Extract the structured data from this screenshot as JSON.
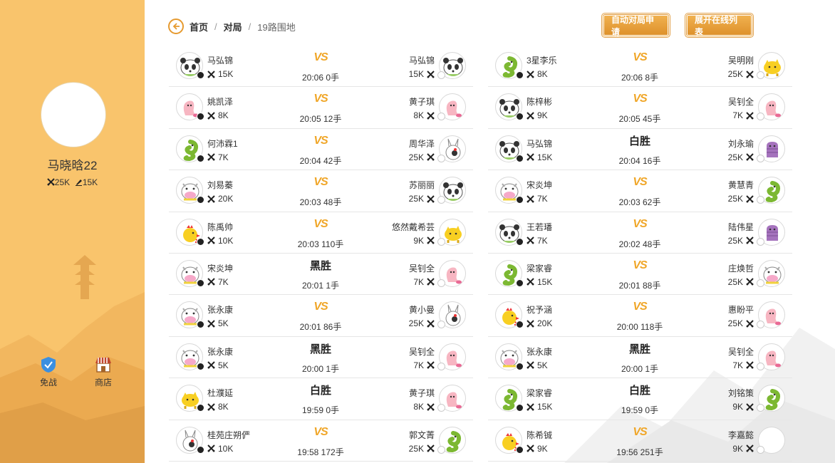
{
  "profile": {
    "name": "马晓晗22",
    "rank_a": "25K",
    "rank_b": "15K"
  },
  "sidebar": {
    "free_label": "免战",
    "shop_label": "商店"
  },
  "breadcrumb": {
    "home": "首页",
    "section": "对局",
    "current": "19路围地"
  },
  "header": {
    "auto_match_label": "自动对局申请",
    "expand_online_label": "展开在线列表"
  },
  "colors": {
    "sidebar_bg": "#f9c46c",
    "accent": "#e69a2f",
    "vs": "#f0a628"
  },
  "games_left": [
    {
      "p1": {
        "name": "马弘锦",
        "rank": "15K",
        "avatar": "panda",
        "stone": "black"
      },
      "result": "VS",
      "time": "20:06",
      "moves": "0手",
      "p2": {
        "name": "马弘锦",
        "rank": "15K",
        "avatar": "panda",
        "stone": "white"
      }
    },
    {
      "p1": {
        "name": "姚凯泽",
        "rank": "8K",
        "avatar": "pink-blob",
        "stone": "black"
      },
      "result": "VS",
      "time": "20:05",
      "moves": "12手",
      "p2": {
        "name": "黄子琪",
        "rank": "8K",
        "avatar": "pink-blob",
        "stone": "white"
      }
    },
    {
      "p1": {
        "name": "何沛霖1",
        "rank": "7K",
        "avatar": "green-blob",
        "stone": "black"
      },
      "result": "VS",
      "time": "20:04",
      "moves": "42手",
      "p2": {
        "name": "周华泽",
        "rank": "25K",
        "avatar": "white-bunny",
        "stone": "white"
      }
    },
    {
      "p1": {
        "name": "刘易蓁",
        "rank": "20K",
        "avatar": "pink-cow",
        "stone": "black"
      },
      "result": "VS",
      "time": "20:03",
      "moves": "48手",
      "p2": {
        "name": "苏丽丽",
        "rank": "25K",
        "avatar": "panda",
        "stone": "white"
      }
    },
    {
      "p1": {
        "name": "陈禹帅",
        "rank": "10K",
        "avatar": "chick",
        "stone": "black"
      },
      "result": "VS",
      "time": "20:03",
      "moves": "110手",
      "p2": {
        "name": "悠然戴希芸",
        "rank": "9K",
        "avatar": "yellow-blob",
        "stone": "white"
      }
    },
    {
      "p1": {
        "name": "宋炎坤",
        "rank": "7K",
        "avatar": "pink-cow",
        "stone": "black"
      },
      "result": "黑胜",
      "time": "20:01",
      "moves": "1手",
      "p2": {
        "name": "吴钊全",
        "rank": "7K",
        "avatar": "pink-blob",
        "stone": "white"
      }
    },
    {
      "p1": {
        "name": "张永康",
        "rank": "5K",
        "avatar": "pink-cow",
        "stone": "black"
      },
      "result": "VS",
      "time": "20:01",
      "moves": "86手",
      "p2": {
        "name": "黄小曼",
        "rank": "25K",
        "avatar": "white-bunny",
        "stone": "white"
      }
    },
    {
      "p1": {
        "name": "张永康",
        "rank": "5K",
        "avatar": "pink-cow",
        "stone": "black"
      },
      "result": "黑胜",
      "time": "20:00",
      "moves": "1手",
      "p2": {
        "name": "吴钊全",
        "rank": "7K",
        "avatar": "pink-blob",
        "stone": "white"
      }
    },
    {
      "p1": {
        "name": "杜濮延",
        "rank": "8K",
        "avatar": "yellow-blob",
        "stone": "black"
      },
      "result": "白胜",
      "time": "19:59",
      "moves": "0手",
      "p2": {
        "name": "黄子琪",
        "rank": "8K",
        "avatar": "pink-blob",
        "stone": "white"
      }
    },
    {
      "p1": {
        "name": "桂苑庄朔俨",
        "rank": "10K",
        "avatar": "white-bunny",
        "stone": "black"
      },
      "result": "VS",
      "time": "19:58",
      "moves": "172手",
      "p2": {
        "name": "郭文菁",
        "rank": "25K",
        "avatar": "green-blob",
        "stone": "white"
      }
    }
  ],
  "games_right": [
    {
      "p1": {
        "name": "3星李乐",
        "rank": "8K",
        "avatar": "green-blob",
        "stone": "black"
      },
      "result": "VS",
      "time": "20:06",
      "moves": "8手",
      "p2": {
        "name": "吴明刚",
        "rank": "25K",
        "avatar": "yellow-blob",
        "stone": "white"
      }
    },
    {
      "p1": {
        "name": "陈梓彬",
        "rank": "9K",
        "avatar": "panda",
        "stone": "black"
      },
      "result": "VS",
      "time": "20:05",
      "moves": "45手",
      "p2": {
        "name": "吴钊全",
        "rank": "7K",
        "avatar": "pink-blob",
        "stone": "white"
      }
    },
    {
      "p1": {
        "name": "马弘锦",
        "rank": "15K",
        "avatar": "panda",
        "stone": "black"
      },
      "result": "白胜",
      "time": "20:04",
      "moves": "16手",
      "p2": {
        "name": "刘永瑜",
        "rank": "25K",
        "avatar": "purple-blob",
        "stone": "white"
      }
    },
    {
      "p1": {
        "name": "宋炎坤",
        "rank": "7K",
        "avatar": "pink-cow",
        "stone": "black"
      },
      "result": "VS",
      "time": "20:03",
      "moves": "62手",
      "p2": {
        "name": "黄慧青",
        "rank": "25K",
        "avatar": "green-blob",
        "stone": "white"
      }
    },
    {
      "p1": {
        "name": "王若璠",
        "rank": "7K",
        "avatar": "panda",
        "stone": "black"
      },
      "result": "VS",
      "time": "20:02",
      "moves": "48手",
      "p2": {
        "name": "陆伟星",
        "rank": "25K",
        "avatar": "purple-blob",
        "stone": "white"
      }
    },
    {
      "p1": {
        "name": "梁家睿",
        "rank": "15K",
        "avatar": "green-blob",
        "stone": "black"
      },
      "result": "VS",
      "time": "20:01",
      "moves": "88手",
      "p2": {
        "name": "庄焕哲",
        "rank": "25K",
        "avatar": "pink-cow",
        "stone": "white"
      }
    },
    {
      "p1": {
        "name": "祝予涵",
        "rank": "20K",
        "avatar": "chick",
        "stone": "black"
      },
      "result": "VS",
      "time": "20:00",
      "moves": "118手",
      "p2": {
        "name": "惠盼平",
        "rank": "25K",
        "avatar": "pink-blob",
        "stone": "white"
      }
    },
    {
      "p1": {
        "name": "张永康",
        "rank": "5K",
        "avatar": "pink-cow",
        "stone": "black"
      },
      "result": "黑胜",
      "time": "20:00",
      "moves": "1手",
      "p2": {
        "name": "吴钊全",
        "rank": "7K",
        "avatar": "pink-blob",
        "stone": "white"
      }
    },
    {
      "p1": {
        "name": "梁家睿",
        "rank": "15K",
        "avatar": "green-blob",
        "stone": "black"
      },
      "result": "白胜",
      "time": "19:59",
      "moves": "0手",
      "p2": {
        "name": "刘铭策",
        "rank": "9K",
        "avatar": "green-blob",
        "stone": "white"
      }
    },
    {
      "p1": {
        "name": "陈希铖",
        "rank": "9K",
        "avatar": "chick",
        "stone": "black"
      },
      "result": "VS",
      "time": "19:56",
      "moves": "251手",
      "p2": {
        "name": "李嘉懿",
        "rank": "9K",
        "avatar": "empty",
        "stone": "white"
      }
    }
  ]
}
